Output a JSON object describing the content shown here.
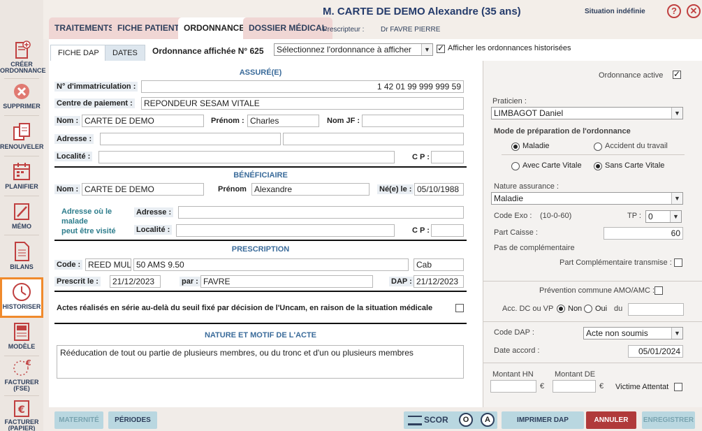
{
  "sidebar": {
    "items": [
      {
        "label": "CRÉER",
        "label2": "ORDONNANCE",
        "icon": "create-prescription-icon"
      },
      {
        "label": "SUPPRIMER",
        "icon": "delete-icon"
      },
      {
        "label": "RENOUVELER",
        "icon": "renew-icon"
      },
      {
        "label": "PLANIFIER",
        "icon": "calendar-icon"
      },
      {
        "label": "MÉMO",
        "icon": "memo-icon"
      },
      {
        "label": "BILANS",
        "icon": "report-icon"
      },
      {
        "label": "HISTORISER",
        "icon": "clock-icon"
      },
      {
        "label": "MODÈLE",
        "icon": "template-icon"
      },
      {
        "label": "FACTURER",
        "label2": "(FSE)",
        "icon": "euro-stars-icon"
      },
      {
        "label": "FACTURER",
        "label2": "(PAPIER)",
        "icon": "euro-paper-icon"
      }
    ]
  },
  "header": {
    "tabs": [
      "TRAITEMENTS",
      "FICHE PATIENT",
      "ORDONNANCES",
      "DOSSIER MÉDICAL"
    ],
    "patient_title": "M. CARTE DE DEMO Alexandre (35 ans)",
    "prescripteur_label": "Prescripteur :",
    "prescripteur_value": "Dr FAVRE PIERRE",
    "situation": "Situation indéfinie",
    "help": "?"
  },
  "subtabs": [
    "FICHE DAP",
    "DATES"
  ],
  "ordonnance_label": "Ordonnance affichée N° 625",
  "ordonnance_select": "Sélectionnez l'ordonnance à afficher",
  "historised_label": "Afficher les ordonnances historisées",
  "assure": {
    "section": "ASSURÉ(E)",
    "immat_label": "N° d'immatriculation :",
    "immat_value": "1 42 01 99 999 999 59",
    "centre_label": "Centre de paiement :",
    "centre_value": "REPONDEUR SESAM VITALE",
    "nom_label": "Nom :",
    "nom_value": "CARTE DE DEMO",
    "prenom_label": "Prénom :",
    "prenom_value": "Charles",
    "nomjf_label": "Nom JF :",
    "adresse_label": "Adresse :",
    "localite_label": "Localité :",
    "cp_label": "C P :"
  },
  "beneficiaire": {
    "section": "BÉNÉFICIAIRE",
    "nom_label": "Nom :",
    "nom_value": "CARTE DE DEMO",
    "prenom_label": "Prénom",
    "prenom_value": "Alexandre",
    "naissance_label": "Né(e) le :",
    "naissance_value": "05/10/1988",
    "adresse_visite_1": "Adresse où le",
    "adresse_visite_2": "malade",
    "adresse_visite_3": "peut être visité",
    "adresse_label": "Adresse :",
    "localite_label": "Localité :",
    "cp_label": "C P :"
  },
  "prescription": {
    "section": "PRESCRIPTION",
    "code_label": "Code :",
    "code_value": "REED MUL",
    "code_desc": "50 AMS 9.50",
    "code_place": "Cab",
    "prescrit_label": "Prescrit le :",
    "prescrit_value": "21/12/2023",
    "par_label": "par :",
    "par_value": "FAVRE",
    "dap_label": "DAP :",
    "dap_value": "21/12/2023",
    "serie_label": "Actes réalisés en série au-delà du seuil fixé par décision de l'Uncam, en raison de la situation médicale"
  },
  "nature": {
    "section": "NATURE ET MOTIF DE L'ACTE",
    "text": "Rééducation de tout ou partie de plusieurs membres, ou du tronc et d'un ou plusieurs membres"
  },
  "right": {
    "active_label": "Ordonnance active",
    "praticien_label": "Praticien :",
    "praticien_value": "LIMBAGOT Daniel",
    "mode_title": "Mode de préparation de l'ordonnance",
    "maladie": "Maladie",
    "accident": "Accident du travail",
    "avec_carte": "Avec Carte Vitale",
    "sans_carte": "Sans Carte Vitale",
    "nature_label": "Nature assurance :",
    "nature_value": "Maladie",
    "code_exo_label": "Code Exo :",
    "code_exo_range": "(10-0-60)",
    "tp_label": "TP :",
    "tp_value": "0",
    "part_caisse_label": "Part Caisse :",
    "part_caisse_value": "60",
    "pas_compl": "Pas de complémentaire",
    "part_compl_label": "Part Complémentaire transmise :",
    "prevention_label": "Prévention commune AMO/AMC :",
    "acc_label": "Acc. DC ou VP",
    "non": "Non",
    "oui": "Oui",
    "du": "du",
    "code_dap_label": "Code DAP :",
    "code_dap_value": "Acte non soumis",
    "date_accord_label": "Date accord :",
    "date_accord_value": "05/01/2024",
    "montant_hn_label": "Montant HN",
    "montant_de_label": "Montant DE",
    "euro": "€",
    "victime_label": "Victime Attentat"
  },
  "footer": {
    "maternite": "MATERNITÉ",
    "periodes": "PÉRIODES",
    "scor": "SCOR",
    "o": "O",
    "a": "A",
    "imprimer": "IMPRIMER DAP",
    "annuler": "ANNULER",
    "enregistrer": "ENREGISTRER"
  },
  "colors": {
    "accent_tab": "#f0d6d4",
    "annuler": "#b03a3a",
    "active_outline": "#f08a2c"
  }
}
